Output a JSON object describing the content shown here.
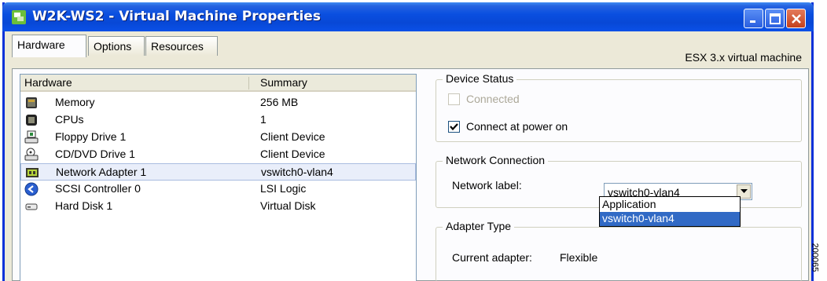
{
  "window": {
    "title": "W2K-WS2 - Virtual Machine Properties",
    "buttons": {
      "minimize": "minimize",
      "maximize": "maximize",
      "close": "close"
    }
  },
  "tabs": [
    {
      "label": "Hardware",
      "active": true
    },
    {
      "label": "Options",
      "active": false
    },
    {
      "label": "Resources",
      "active": false
    }
  ],
  "vm_type": "ESX 3.x virtual machine",
  "hardware": {
    "columns": {
      "hardware": "Hardware",
      "summary": "Summary"
    },
    "items": [
      {
        "icon": "memory-icon",
        "name": "Memory",
        "summary": "256 MB"
      },
      {
        "icon": "cpu-icon",
        "name": "CPUs",
        "summary": "1"
      },
      {
        "icon": "floppy-drive-icon",
        "name": "Floppy Drive 1",
        "summary": "Client Device"
      },
      {
        "icon": "cd-dvd-drive-icon",
        "name": "CD/DVD Drive 1",
        "summary": "Client Device"
      },
      {
        "icon": "network-adapter-icon",
        "name": "Network Adapter 1",
        "summary": "vswitch0-vlan4",
        "selected": true
      },
      {
        "icon": "scsi-controller-icon",
        "name": "SCSI Controller 0",
        "summary": "LSI Logic"
      },
      {
        "icon": "hard-disk-icon",
        "name": "Hard Disk 1",
        "summary": "Virtual Disk"
      }
    ]
  },
  "device_status": {
    "legend": "Device Status",
    "connected": {
      "label": "Connected",
      "checked": false,
      "enabled": false
    },
    "connect_at_power_on": {
      "label": "Connect at power on",
      "checked": true,
      "enabled": true
    }
  },
  "network_connection": {
    "legend": "Network Connection",
    "label": "Network label:",
    "value": "vswitch0-vlan4",
    "options": [
      "Application",
      "vswitch0-vlan4"
    ],
    "highlighted": "vswitch0-vlan4"
  },
  "adapter_type": {
    "legend": "Adapter Type",
    "label": "Current adapter:",
    "value": "Flexible"
  },
  "figure_code": "200065"
}
